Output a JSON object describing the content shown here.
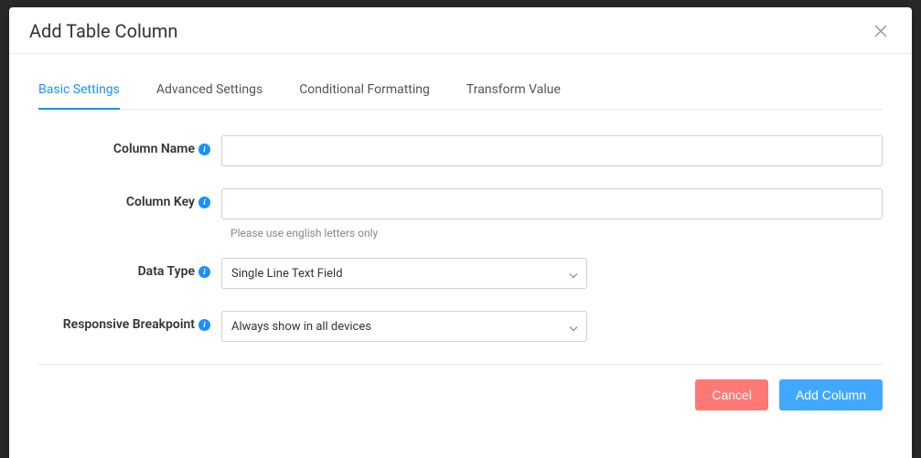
{
  "modal": {
    "title": "Add Table Column"
  },
  "tabs": [
    {
      "label": "Basic Settings",
      "active": true
    },
    {
      "label": "Advanced Settings",
      "active": false
    },
    {
      "label": "Conditional Formatting",
      "active": false
    },
    {
      "label": "Transform Value",
      "active": false
    }
  ],
  "form": {
    "columnName": {
      "label": "Column Name",
      "value": ""
    },
    "columnKey": {
      "label": "Column Key",
      "value": "",
      "hint": "Please use english letters only"
    },
    "dataType": {
      "label": "Data Type",
      "value": "Single Line Text Field"
    },
    "responsiveBreakpoint": {
      "label": "Responsive Breakpoint",
      "value": "Always show in all devices"
    }
  },
  "footer": {
    "cancel": "Cancel",
    "submit": "Add Column"
  }
}
